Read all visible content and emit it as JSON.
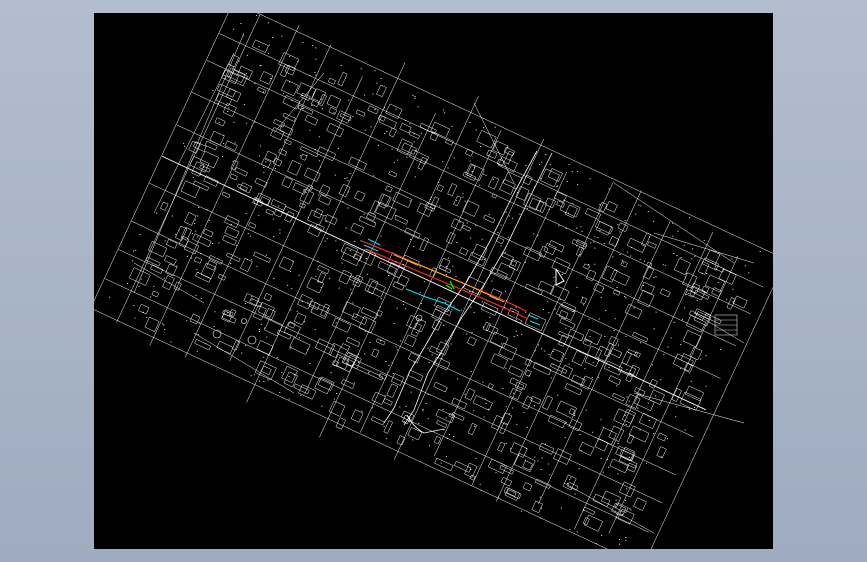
{
  "app": {
    "background_color": "#a7b3c6"
  },
  "viewport": {
    "background_color": "#000000",
    "linework_color": "#ffffff",
    "highlight_colors": {
      "route_primary": "#ff2a1a",
      "route_secondary": "#ffd800",
      "route_tertiary": "#00e000",
      "annotation": "#00e5ff"
    }
  },
  "cursor": {
    "icon": "crosshair-cursor-icon"
  }
}
